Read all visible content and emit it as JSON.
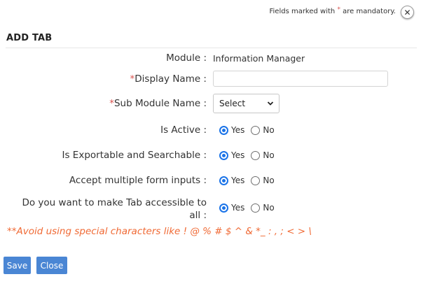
{
  "header": {
    "note_prefix": "Fields marked with ",
    "note_star": "*",
    "note_suffix": " are mandatory.",
    "close_icon_glyph": "✕"
  },
  "title": "ADD TAB",
  "form": {
    "module": {
      "label": "Module :",
      "value": "Information Manager"
    },
    "display_name": {
      "required_mark": "*",
      "label": "Display Name :",
      "value": "",
      "placeholder": ""
    },
    "sub_module": {
      "required_mark": "*",
      "label": "Sub Module Name :",
      "selected": "Select"
    },
    "is_active": {
      "label": "Is Active :",
      "yes": "Yes",
      "no": "No",
      "selected": "Yes"
    },
    "exportable": {
      "label": "Is Exportable and Searchable :",
      "yes": "Yes",
      "no": "No",
      "selected": "Yes"
    },
    "multiple_inputs": {
      "label": "Accept multiple form inputs :",
      "yes": "Yes",
      "no": "No",
      "selected": "Yes"
    },
    "accessible": {
      "label_line1": "Do you want to make Tab accessible to",
      "label_line2": "all :",
      "yes": "Yes",
      "no": "No",
      "selected": "Yes"
    }
  },
  "warning": "**Avoid using special characters like ! @ % # $ ^ & *_ : , ; < > \\",
  "buttons": {
    "save": "Save",
    "close": "Close"
  },
  "colors": {
    "accent": "#1a73e8",
    "button": "#4a86d4",
    "required": "#d9534f",
    "warning": "#f06a35"
  }
}
